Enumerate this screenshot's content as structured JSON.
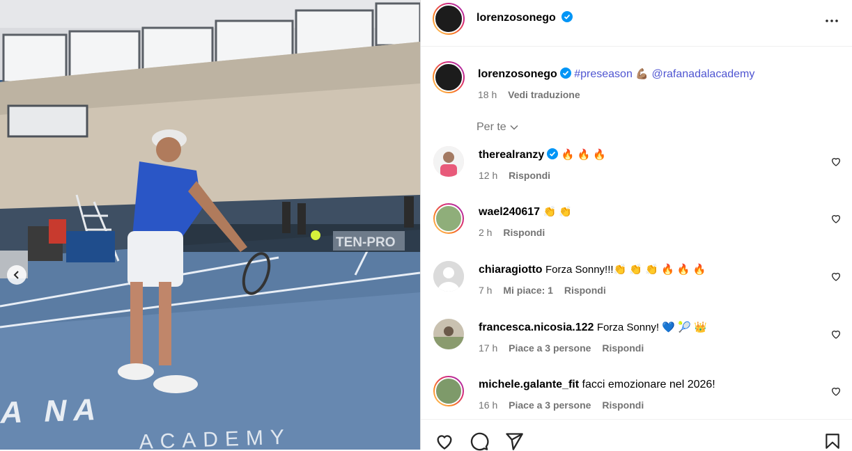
{
  "post": {
    "author": "lorenzosonego",
    "caption": {
      "hashtag": "#preseason",
      "emoji": "💪🏽",
      "mention": "@rafanadalacademy"
    },
    "time": "18 h",
    "translate_label": "Vedi traduzione"
  },
  "media": {
    "court_sign": "TEN-PRO",
    "floor_text_1": "RAFA NA",
    "floor_text_2": "ACADEMY"
  },
  "filter_label": "Per te",
  "comments": [
    {
      "user": "therealranzy",
      "verified": true,
      "text": "🔥 🔥 🔥",
      "time": "12 h",
      "likes": "",
      "reply": "Rispondi"
    },
    {
      "user": "wael240617",
      "verified": false,
      "text": "👏 👏",
      "time": "2 h",
      "likes": "",
      "reply": "Rispondi"
    },
    {
      "user": "chiaragiotto",
      "verified": false,
      "text": "Forza Sonny!!!👏 👏 👏 🔥 🔥 🔥",
      "time": "7 h",
      "likes": "Mi piace: 1",
      "reply": "Rispondi"
    },
    {
      "user": "francesca.nicosia.122",
      "verified": false,
      "text": "Forza Sonny! 💙 🎾 👑",
      "time": "17 h",
      "likes": "Piace a 3 persone",
      "reply": "Rispondi"
    },
    {
      "user": "michele.galante_fit",
      "verified": false,
      "text": "facci emozionare nel 2026!",
      "time": "16 h",
      "likes": "Piace a 3 persone",
      "reply": "Rispondi"
    }
  ],
  "colors": {
    "link": "#4f55d1",
    "verified": "#0095f6",
    "muted": "#737373"
  }
}
